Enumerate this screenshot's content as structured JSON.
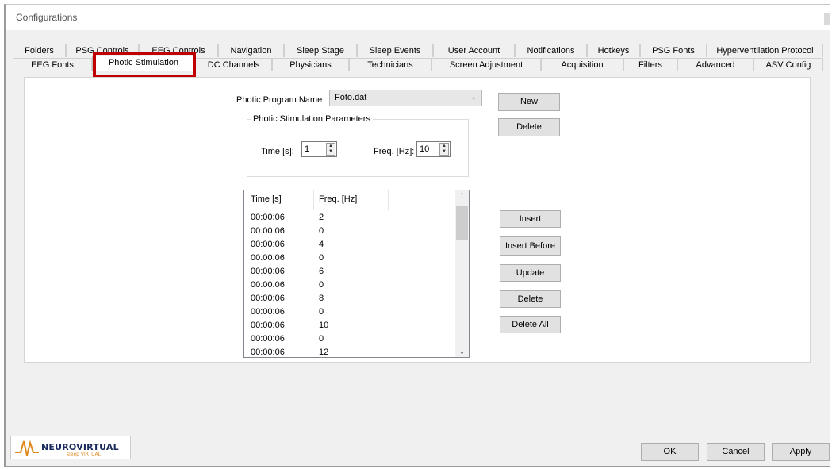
{
  "window": {
    "title": "Configurations"
  },
  "tabs_row1": [
    {
      "label": "Folders"
    },
    {
      "label": "PSG Controls"
    },
    {
      "label": "EEG Controls"
    },
    {
      "label": "Navigation"
    },
    {
      "label": "Sleep Stage"
    },
    {
      "label": "Sleep Events"
    },
    {
      "label": "User Account"
    },
    {
      "label": "Notifications"
    },
    {
      "label": "Hotkeys"
    },
    {
      "label": "PSG Fonts"
    },
    {
      "label": "Hyperventilation Protocol"
    }
  ],
  "tabs_row2": [
    {
      "label": "EEG Fonts"
    },
    {
      "label": "Photic Stimulation"
    },
    {
      "label": "DC Channels"
    },
    {
      "label": "Physicians"
    },
    {
      "label": "Technicians"
    },
    {
      "label": "Screen Adjustment"
    },
    {
      "label": "Acquisition"
    },
    {
      "label": "Filters"
    },
    {
      "label": "Advanced"
    },
    {
      "label": "ASV Config"
    }
  ],
  "active_tab": "Photic Stimulation",
  "highlight_color": "#c00000",
  "photic": {
    "program_label": "Photic Program Name",
    "program_value": "Foto.dat",
    "new_button": "New",
    "delete_button": "Delete",
    "group_title": "Photic Stimulation Parameters",
    "time_label": "Time [s]:",
    "time_value": "1",
    "freq_label": "Freq. [Hz]:",
    "freq_value": "10"
  },
  "list": {
    "headers": [
      "Time [s]",
      "Freq. [Hz]"
    ],
    "rows": [
      {
        "time": "00:00:06",
        "freq": "2"
      },
      {
        "time": "00:00:06",
        "freq": "0"
      },
      {
        "time": "00:00:06",
        "freq": "4"
      },
      {
        "time": "00:00:06",
        "freq": "0"
      },
      {
        "time": "00:00:06",
        "freq": "6"
      },
      {
        "time": "00:00:06",
        "freq": "0"
      },
      {
        "time": "00:00:06",
        "freq": "8"
      },
      {
        "time": "00:00:06",
        "freq": "0"
      },
      {
        "time": "00:00:06",
        "freq": "10"
      },
      {
        "time": "00:00:06",
        "freq": "0"
      },
      {
        "time": "00:00:06",
        "freq": "12"
      }
    ]
  },
  "list_buttons": {
    "insert": "Insert",
    "insert_before": "Insert Before",
    "update": "Update",
    "delete": "Delete",
    "delete_all": "Delete All"
  },
  "footer": {
    "logo_text": "NEUROVIRTUAL",
    "logo_sub": "sleep VIRTUAL",
    "ok": "OK",
    "cancel": "Cancel",
    "apply": "Apply"
  }
}
